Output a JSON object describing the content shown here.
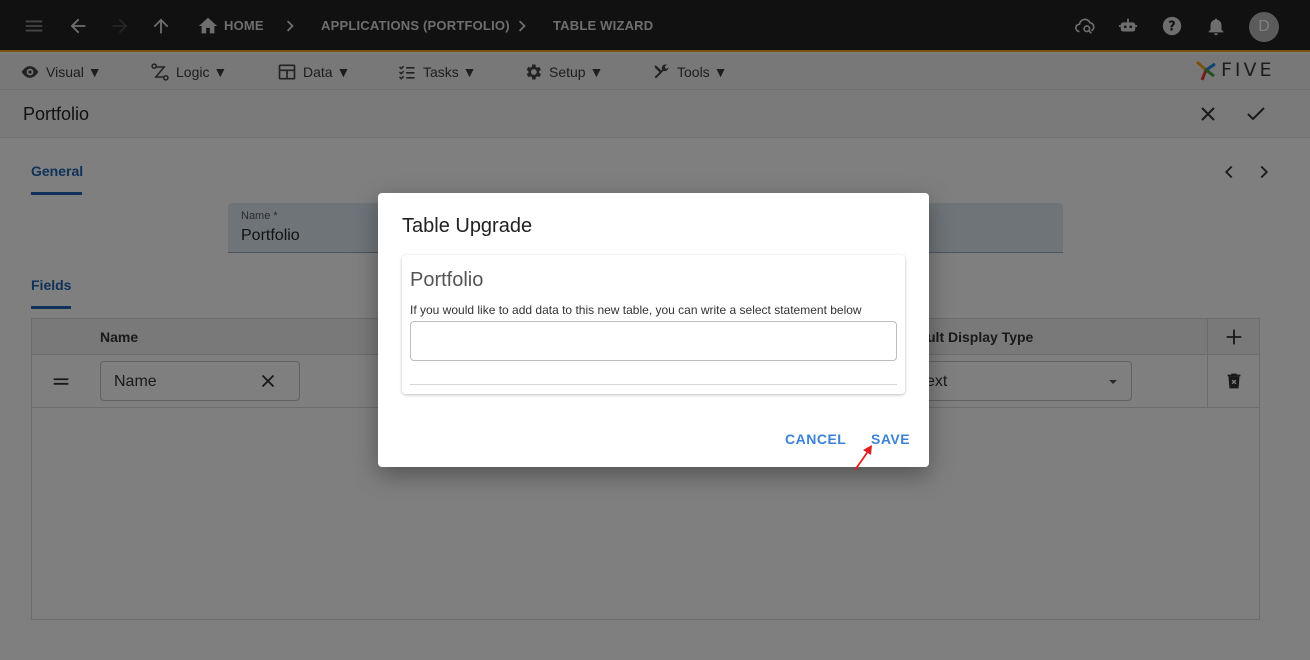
{
  "topbar": {
    "breadcrumbs": [
      "HOME",
      "APPLICATIONS (PORTFOLIO)",
      "TABLE WIZARD"
    ],
    "avatar_initial": "D"
  },
  "menubar": {
    "items": [
      {
        "label": "Visual ▼",
        "icon": "eye-icon"
      },
      {
        "label": "Logic ▼",
        "icon": "logic-icon"
      },
      {
        "label": "Data ▼",
        "icon": "table-icon"
      },
      {
        "label": "Tasks ▼",
        "icon": "tasks-icon"
      },
      {
        "label": "Setup ▼",
        "icon": "gear-icon"
      },
      {
        "label": "Tools ▼",
        "icon": "tools-icon"
      }
    ],
    "logo_text": "FIVE"
  },
  "page": {
    "title": "Portfolio"
  },
  "form": {
    "tab_general": "General",
    "name_label": "Name *",
    "name_value": "Portfolio",
    "tab_fields": "Fields",
    "grid": {
      "col_name": "Name",
      "col_display": "ult Display Type",
      "row_name_value": "Name",
      "row_display_value": "ext"
    }
  },
  "dialog": {
    "title": "Table Upgrade",
    "card_title": "Portfolio",
    "card_desc": "If you would like to add data to this new table, you can write a select statement below",
    "input_value": "",
    "cancel_label": "CANCEL",
    "save_label": "SAVE"
  },
  "colors": {
    "accent": "#1e63b4",
    "topbar": "#232323",
    "topbar_border": "#f4a51c",
    "button": "#3d82d6",
    "arrow": "#e02020"
  }
}
